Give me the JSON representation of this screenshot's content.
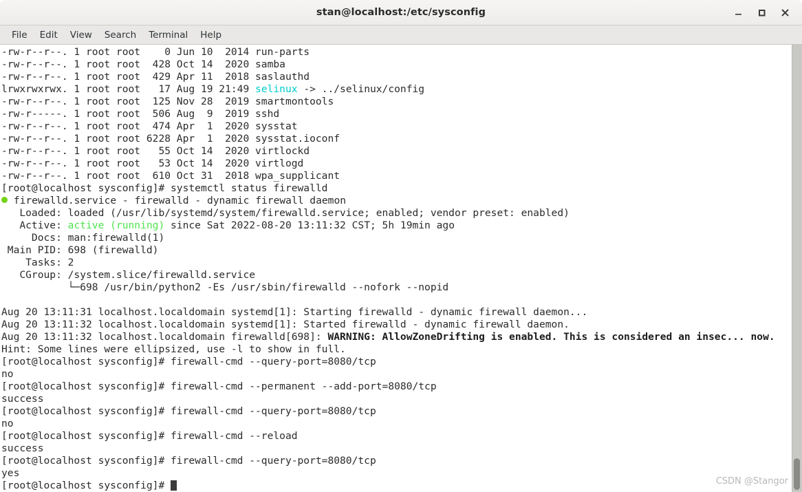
{
  "window": {
    "title": "stan@localhost:/etc/sysconfig",
    "controls": {
      "minimize": "minimize",
      "maximize": "maximize",
      "close": "close"
    }
  },
  "menubar": {
    "items": [
      {
        "label": "File"
      },
      {
        "label": "Edit"
      },
      {
        "label": "View"
      },
      {
        "label": "Search"
      },
      {
        "label": "Terminal"
      },
      {
        "label": "Help"
      }
    ]
  },
  "terminal": {
    "lines": [
      {
        "segments": [
          {
            "text": "-rw-r--r--. 1 root root    0 Jun 10  2014 run-parts"
          }
        ]
      },
      {
        "segments": [
          {
            "text": "-rw-r--r--. 1 root root  428 Oct 14  2020 samba"
          }
        ]
      },
      {
        "segments": [
          {
            "text": "-rw-r--r--. 1 root root  429 Apr 11  2018 saslauthd"
          }
        ]
      },
      {
        "segments": [
          {
            "text": "lrwxrwxrwx. 1 root root   17 Aug 19 21:49 "
          },
          {
            "text": "selinux",
            "style": "cyan"
          },
          {
            "text": " -> ../selinux/config"
          }
        ]
      },
      {
        "segments": [
          {
            "text": "-rw-r--r--. 1 root root  125 Nov 28  2019 smartmontools"
          }
        ]
      },
      {
        "segments": [
          {
            "text": "-rw-r-----. 1 root root  506 Aug  9  2019 sshd"
          }
        ]
      },
      {
        "segments": [
          {
            "text": "-rw-r--r--. 1 root root  474 Apr  1  2020 sysstat"
          }
        ]
      },
      {
        "segments": [
          {
            "text": "-rw-r--r--. 1 root root 6228 Apr  1  2020 sysstat.ioconf"
          }
        ]
      },
      {
        "segments": [
          {
            "text": "-rw-r--r--. 1 root root   55 Oct 14  2020 virtlockd"
          }
        ]
      },
      {
        "segments": [
          {
            "text": "-rw-r--r--. 1 root root   53 Oct 14  2020 virtlogd"
          }
        ]
      },
      {
        "segments": [
          {
            "text": "-rw-r--r--. 1 root root  610 Oct 31  2018 wpa_supplicant"
          }
        ]
      },
      {
        "segments": [
          {
            "text": "[root@localhost sysconfig]# systemctl status firewalld"
          }
        ]
      },
      {
        "segments": [
          {
            "text": "",
            "style": "dot"
          },
          {
            "text": " firewalld.service - firewalld - dynamic firewall daemon"
          }
        ]
      },
      {
        "segments": [
          {
            "text": "   Loaded: loaded (/usr/lib/systemd/system/firewalld.service; enabled; vendor preset: enabled)"
          }
        ]
      },
      {
        "segments": [
          {
            "text": "   Active: "
          },
          {
            "text": "active (running)",
            "style": "green"
          },
          {
            "text": " since Sat 2022-08-20 13:11:32 CST; 5h 19min ago"
          }
        ]
      },
      {
        "segments": [
          {
            "text": "     Docs: man:firewalld(1)"
          }
        ]
      },
      {
        "segments": [
          {
            "text": " Main PID: 698 (firewalld)"
          }
        ]
      },
      {
        "segments": [
          {
            "text": "    Tasks: 2"
          }
        ]
      },
      {
        "segments": [
          {
            "text": "   CGroup: /system.slice/firewalld.service"
          }
        ]
      },
      {
        "segments": [
          {
            "text": "           └─698 /usr/bin/python2 -Es /usr/sbin/firewalld --nofork --nopid"
          }
        ]
      },
      {
        "segments": [
          {
            "text": ""
          }
        ]
      },
      {
        "segments": [
          {
            "text": "Aug 20 13:11:31 localhost.localdomain systemd[1]: Starting firewalld - dynamic firewall daemon..."
          }
        ]
      },
      {
        "segments": [
          {
            "text": "Aug 20 13:11:32 localhost.localdomain systemd[1]: Started firewalld - dynamic firewall daemon."
          }
        ]
      },
      {
        "segments": [
          {
            "text": "Aug 20 13:11:32 localhost.localdomain firewalld[698]: "
          },
          {
            "text": "WARNING: AllowZoneDrifting is enabled. This is considered an insec... now.",
            "style": "bold"
          }
        ]
      },
      {
        "segments": [
          {
            "text": "Hint: Some lines were ellipsized, use -l to show in full."
          }
        ]
      },
      {
        "segments": [
          {
            "text": "[root@localhost sysconfig]# firewall-cmd --query-port=8080/tcp"
          }
        ]
      },
      {
        "segments": [
          {
            "text": "no"
          }
        ]
      },
      {
        "segments": [
          {
            "text": "[root@localhost sysconfig]# firewall-cmd --permanent --add-port=8080/tcp"
          }
        ]
      },
      {
        "segments": [
          {
            "text": "success"
          }
        ]
      },
      {
        "segments": [
          {
            "text": "[root@localhost sysconfig]# firewall-cmd --query-port=8080/tcp"
          }
        ]
      },
      {
        "segments": [
          {
            "text": "no"
          }
        ]
      },
      {
        "segments": [
          {
            "text": "[root@localhost sysconfig]# firewall-cmd --reload"
          }
        ]
      },
      {
        "segments": [
          {
            "text": "success"
          }
        ]
      },
      {
        "segments": [
          {
            "text": "[root@localhost sysconfig]# firewall-cmd --query-port=8080/tcp"
          }
        ]
      },
      {
        "segments": [
          {
            "text": "yes"
          }
        ]
      },
      {
        "segments": [
          {
            "text": "[root@localhost sysconfig]# "
          },
          {
            "text": "",
            "style": "cursor"
          }
        ]
      }
    ]
  },
  "scrollbar": {
    "thumb_top_pct": 92.5,
    "thumb_height_pct": 7.0
  },
  "watermark": {
    "text": "CSDN @Stangor"
  },
  "colors": {
    "terminal_bg": "#ffffff",
    "terminal_fg": "#2b2b2b",
    "cyan": "#00cdcd",
    "green": "#4ee44e",
    "status_dot": "#73d216",
    "titlebar_bg": "#f2f1ef",
    "menubar_bg": "#e9e8e6"
  }
}
